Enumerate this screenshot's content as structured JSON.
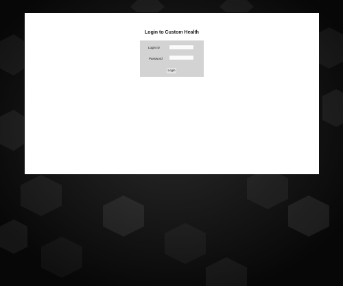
{
  "page": {
    "background_color": "#0e0e0e",
    "panel_color": "#ffffff"
  },
  "login": {
    "title": "Login to Custom Health",
    "login_id_label": "Login ID",
    "login_id_value": "",
    "password_label": "Password",
    "password_value": "",
    "submit_label": "Login",
    "box_color": "#d3d3d3"
  }
}
